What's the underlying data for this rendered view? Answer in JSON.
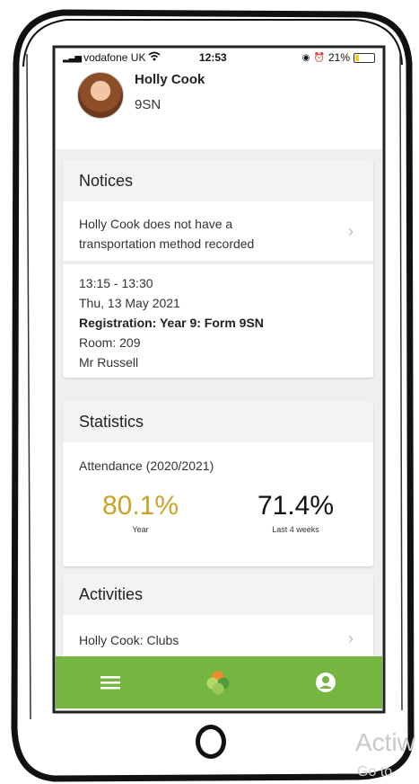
{
  "status_bar": {
    "carrier": "vodafone UK",
    "time": "12:53",
    "battery": "21%",
    "battery_level": 0.21
  },
  "profile": {
    "name": "Holly Cook",
    "form": "9SN"
  },
  "notices": {
    "title": "Notices",
    "transport_line1": "Holly Cook does not have a",
    "transport_line2": "transportation method recorded",
    "lesson": {
      "time": "13:15 - 13:30",
      "date": "Thu, 13 May 2021",
      "registration": "Registration: Year 9: Form 9SN",
      "room": "Room: 209",
      "teacher": "Mr Russell"
    }
  },
  "statistics": {
    "title": "Statistics",
    "attendance_label": "Attendance (2020/2021)",
    "year_value": "80.1%",
    "year_label": "Year",
    "recent_value": "71.4%",
    "recent_label": "Last 4 weeks",
    "year_color": "#c9a227",
    "recent_color": "#111111"
  },
  "activities": {
    "title": "Activities",
    "item": "Holly Cook: Clubs"
  },
  "tab_bar": {
    "color": "#76b640",
    "icons": [
      "menu-icon",
      "logo-icon",
      "profile-icon"
    ]
  },
  "watermark": {
    "text": "Actiw",
    "sub": "Go to"
  }
}
